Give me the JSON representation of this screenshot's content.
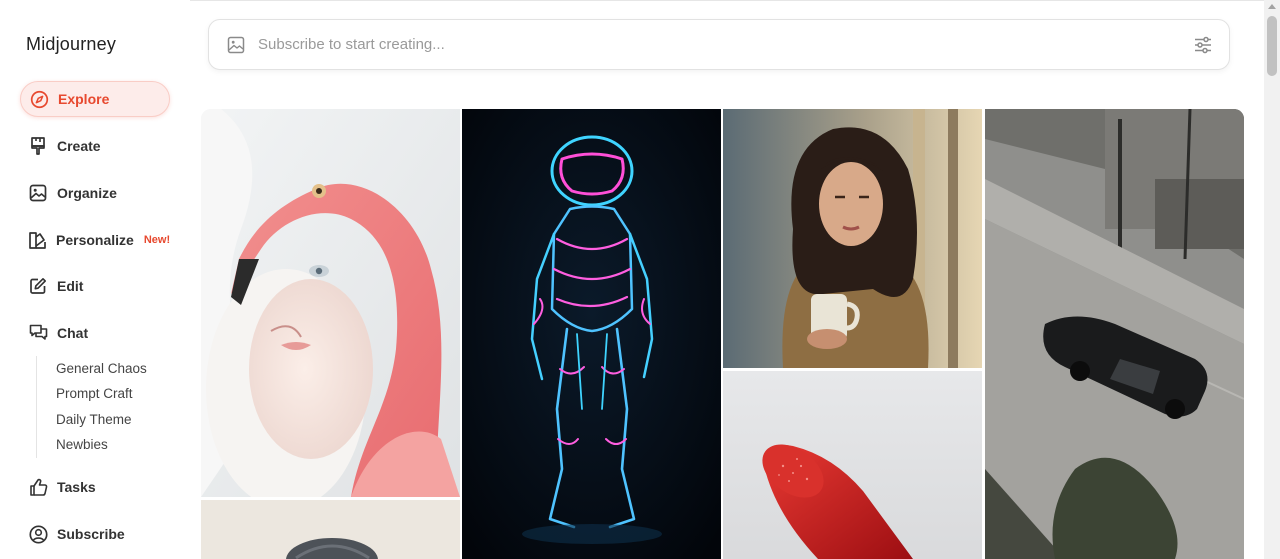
{
  "brand": "Midjourney",
  "nav": {
    "explore": "Explore",
    "create": "Create",
    "organize": "Organize",
    "personalize": "Personalize",
    "personalize_badge": "New!",
    "edit": "Edit",
    "chat": "Chat",
    "tasks": "Tasks",
    "subscribe": "Subscribe"
  },
  "chat_channels": [
    "General Chaos",
    "Prompt Craft",
    "Daily Theme",
    "Newbies"
  ],
  "search": {
    "placeholder": "Subscribe to start creating..."
  },
  "gallery": [
    {
      "subject": "flamingo-portrait"
    },
    {
      "subject": "neon-astronaut"
    },
    {
      "subject": "woman-with-mug"
    },
    {
      "subject": "black-muscle-car-street"
    },
    {
      "subject": "stone-sculpture"
    },
    {
      "subject": "red-lipstick"
    }
  ],
  "colors": {
    "accent": "#e7492f",
    "accent_bg": "#fdecea"
  }
}
